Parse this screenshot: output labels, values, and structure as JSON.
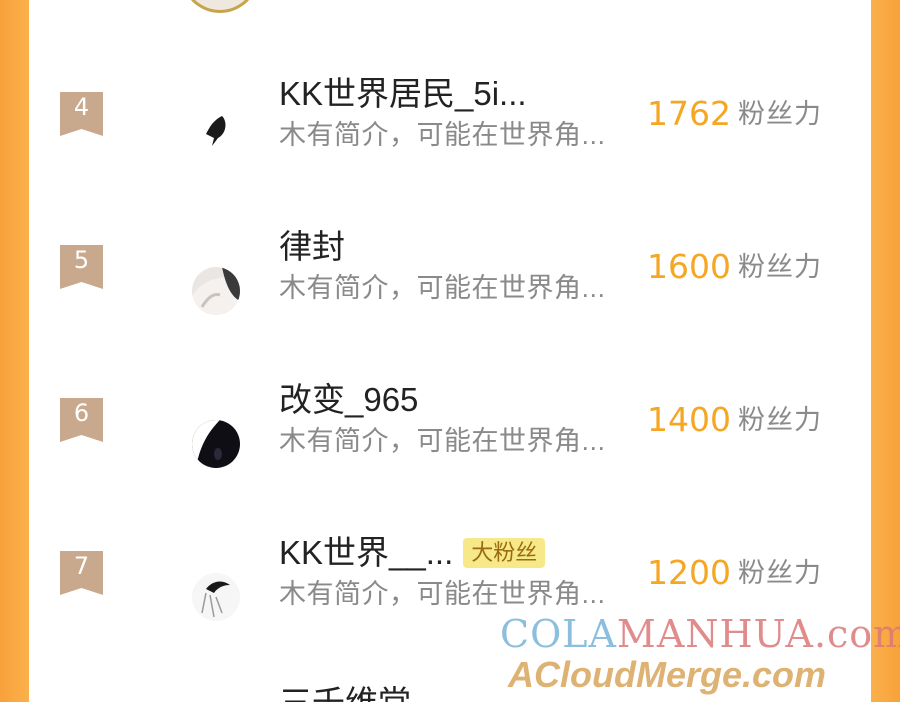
{
  "list": {
    "rows": [
      {
        "rank": "4",
        "name": "KK世界居民_5i...",
        "badge": "",
        "bio": "木有简介，可能在世界角...",
        "score": "1762",
        "score_unit": "粉丝力"
      },
      {
        "rank": "5",
        "name": "律封",
        "badge": "",
        "bio": "木有简介，可能在世界角...",
        "score": "1600",
        "score_unit": "粉丝力"
      },
      {
        "rank": "6",
        "name": "改变_965",
        "badge": "",
        "bio": "木有简介，可能在世界角...",
        "score": "1400",
        "score_unit": "粉丝力"
      },
      {
        "rank": "7",
        "name": "KK世界__...",
        "badge": "大粉丝",
        "bio": "木有简介，可能在世界角...",
        "score": "1200",
        "score_unit": "粉丝力"
      }
    ],
    "partial_next_name": "三千维堂"
  },
  "watermark": {
    "line1_part1": "COLA",
    "line1_part2": "MANHUA.com",
    "line2": "ACloudMerge.com"
  },
  "colors": {
    "background": "#fdb855",
    "rank_badge": "#c8a98d",
    "score": "#f5a623",
    "big_fan_badge": "#f7e98a"
  }
}
